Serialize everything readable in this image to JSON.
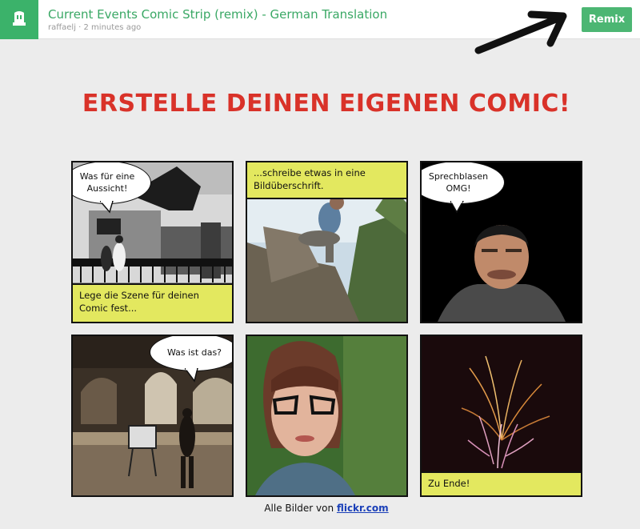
{
  "topbar": {
    "title": "Current Events Comic Strip (remix) - German Translation",
    "meta": "raffaelj · 2 minutes ago",
    "remix_label": "Remix"
  },
  "headline": "ERSTELLE DEINEN EIGENEN COMIC!",
  "panels": {
    "p1": {
      "bubble": "Was für eine Aussicht!",
      "caption": "Lege die Szene für deinen Comic fest..."
    },
    "p2": {
      "caption": "...schreibe etwas in eine Bildüberschrift."
    },
    "p3": {
      "bubble": "Sprechblasen OMG!"
    },
    "p4": {
      "bubble": "Was ist das?"
    },
    "p6": {
      "caption": "Zu Ende!"
    }
  },
  "footer": {
    "text": "Alle Bilder von",
    "link": "flickr.com"
  },
  "colors": {
    "brand_green": "#3bb26a",
    "headline_red": "#d93229",
    "caption_yellow": "#e3e85f"
  }
}
